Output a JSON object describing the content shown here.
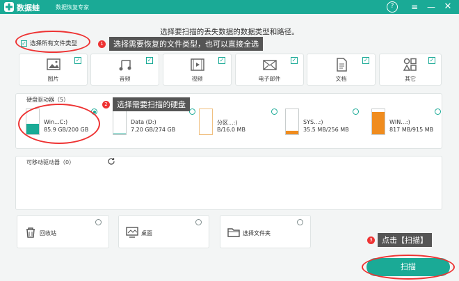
{
  "app": {
    "name": "数据蛙",
    "subtitle": "数据恢复专家"
  },
  "titlebar": {
    "help_icon": "?",
    "menu_icon": "≡",
    "minimize_icon": "—",
    "close_icon": "✕"
  },
  "instruction": "选择要扫描的丢失数据的数据类型和路径。",
  "select_all": {
    "label": "选择所有文件类型",
    "checked": true
  },
  "file_types": [
    {
      "label": "图片",
      "icon": "image-icon",
      "checked": true
    },
    {
      "label": "音频",
      "icon": "audio-icon",
      "checked": true
    },
    {
      "label": "视频",
      "icon": "video-icon",
      "checked": true
    },
    {
      "label": "电子邮件",
      "icon": "email-icon",
      "checked": true
    },
    {
      "label": "文档",
      "icon": "document-icon",
      "checked": true
    },
    {
      "label": "其它",
      "icon": "others-icon",
      "checked": true
    }
  ],
  "hard_drives": {
    "title": "硬盘驱动器（5）",
    "items": [
      {
        "name": "Win...C:)",
        "size": "85.9 GB/200 GB",
        "selected": true,
        "fill": 0.43,
        "color": "#1aaa96"
      },
      {
        "name": "Data (D:)",
        "size": "7.20 GB/274 GB",
        "selected": false,
        "fill": 0.03,
        "color": "#1aaa96"
      },
      {
        "name": "分区...:)",
        "size": "B/16.0 MB",
        "selected": false,
        "fill": 0.0,
        "color": "#f08c1e"
      },
      {
        "name": "SYS...:)",
        "size": "35.5 MB/256 MB",
        "selected": false,
        "fill": 0.14,
        "color": "#f08c1e"
      },
      {
        "name": "WIN...:)",
        "size": "817 MB/915 MB",
        "selected": false,
        "fill": 0.89,
        "color": "#f08c1e"
      }
    ]
  },
  "removable": {
    "title": "可移动驱动器（0）",
    "refresh_icon": "refresh-icon"
  },
  "locations": [
    {
      "label": "回收站",
      "icon": "recycle-bin-icon"
    },
    {
      "label": "桌面",
      "icon": "desktop-icon"
    },
    {
      "label": "选择文件夹",
      "icon": "folder-icon"
    }
  ],
  "callouts": [
    {
      "num": "1",
      "text": "选择需要恢复的文件类型，也可以直接全选"
    },
    {
      "num": "2",
      "text": "选择需要扫描的硬盘"
    },
    {
      "num": "3",
      "text": "点击【扫描】"
    }
  ],
  "scan_button": "扫描",
  "colors": {
    "accent": "#1aaa96",
    "annotation": "#e33333",
    "warning": "#f08c1e"
  }
}
